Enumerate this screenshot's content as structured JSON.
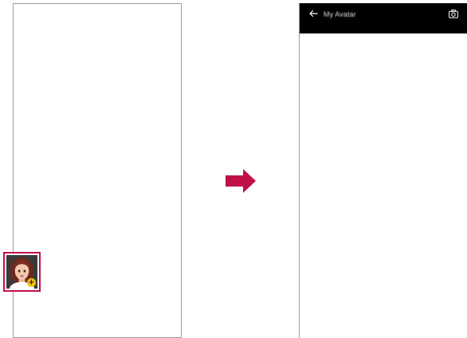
{
  "left_screen": {
    "avatar_tile": {
      "icon": "avatar-add-icon",
      "badge": "+"
    }
  },
  "arrow": {
    "icon": "right-arrow-icon",
    "color": "#c01048"
  },
  "right_screen": {
    "app_bar": {
      "back_icon": "back-arrow-icon",
      "title": "My Avatar",
      "camera_icon": "camera-icon"
    }
  },
  "colors": {
    "highlight": "#c01048",
    "badge": "#f4c20d",
    "app_bar": "#000000"
  }
}
